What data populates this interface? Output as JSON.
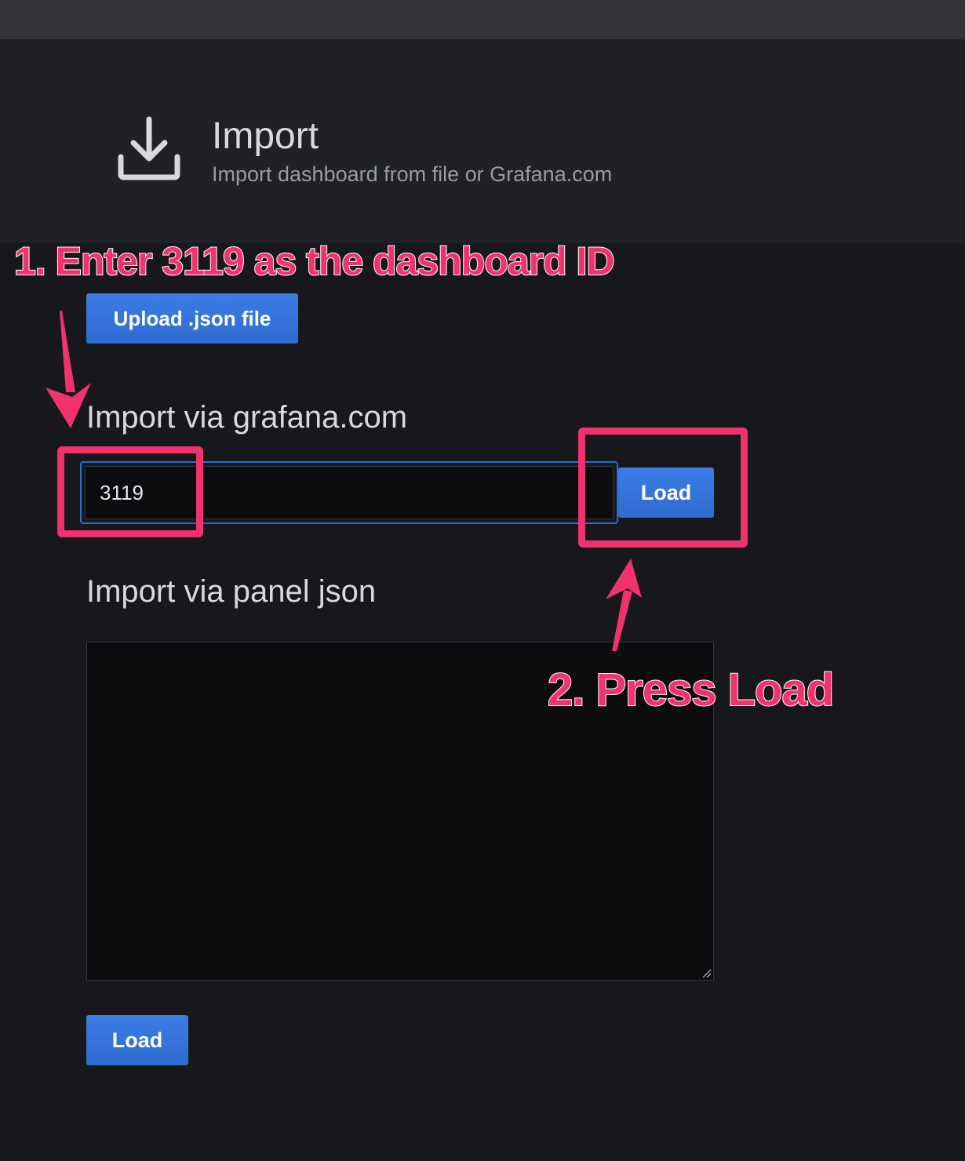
{
  "header": {
    "icon": "download-icon",
    "title": "Import",
    "subtitle": "Import dashboard from file or Grafana.com"
  },
  "upload": {
    "label": "Upload .json file"
  },
  "grafana_com": {
    "title": "Import via grafana.com",
    "input_value": "3119",
    "load_label": "Load"
  },
  "panel_json": {
    "title": "Import via panel json",
    "load_label": "Load"
  },
  "annotations": {
    "step1": "1. Enter 3119 as the dashboard ID",
    "step2": "2. Press Load"
  },
  "colors": {
    "accent": "#3273dc",
    "annotation": "#f0326e",
    "background": "#17181c",
    "header_bg": "#202126"
  }
}
